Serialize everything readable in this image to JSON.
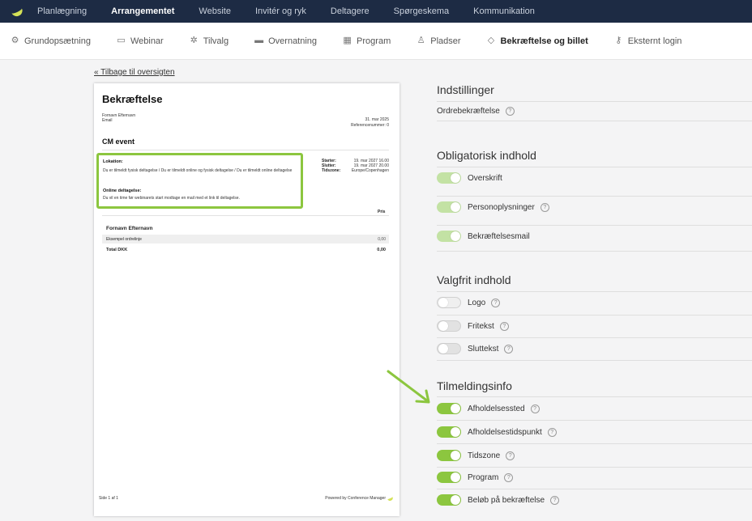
{
  "topnav": {
    "logo_icon": "banana-logo",
    "items": [
      "Planlægning",
      "Arrangementet",
      "Website",
      "Invitér og ryk",
      "Deltagere",
      "Spørgeskema",
      "Kommunikation"
    ],
    "active": "Arrangementet"
  },
  "subnav": {
    "items": [
      {
        "label": "Grundopsætning",
        "icon": "gear-icon"
      },
      {
        "label": "Webinar",
        "icon": "webinar-icon"
      },
      {
        "label": "Tilvalg",
        "icon": "addons-icon"
      },
      {
        "label": "Overnatning",
        "icon": "bed-icon"
      },
      {
        "label": "Program",
        "icon": "calendar-icon"
      },
      {
        "label": "Pladser",
        "icon": "seat-icon"
      },
      {
        "label": "Bekræftelse og billet",
        "icon": "ticket-icon"
      },
      {
        "label": "Eksternt login",
        "icon": "key-icon"
      }
    ],
    "active": "Bekræftelse og billet"
  },
  "back_link": "« Tilbage til oversigten",
  "preview": {
    "title": "Bekræftelse",
    "name": "Fornavn Efternavn",
    "email": "Email",
    "date": "31. mar 2025",
    "reference": "Referencenummer: 0",
    "event": "CM event",
    "location_heading": "Lokation:",
    "location_text": "Du er tilmeldt fysisk deltagelse / Du er tilmeldt online og fysisk deltagelse / Du er tilmeldt online deltagelse",
    "online_heading": "Online deltagelse:",
    "online_text": "Du vil en time før webinarets start modtage en mail med et link til deltagelse.",
    "times": [
      {
        "k": "Starter:",
        "v": "19. mar 2027 16.00"
      },
      {
        "k": "Slutter:",
        "v": "19. mar 2027 20.00"
      },
      {
        "k": "Tidszone:",
        "v": "Europe/Copenhagen"
      }
    ],
    "price_header": "Pris",
    "participant": "Fornavn Efternavn",
    "order_line": "Eksempel ordrelinje",
    "order_value": "0,00",
    "total_label": "Total DKK",
    "total_value": "0,00",
    "footer_left": "Side 1 af 1",
    "footer_right": "Powered by Conference Manager"
  },
  "settings": {
    "sections": [
      {
        "title": "Indstillinger",
        "options": [
          {
            "label": "Ordrebekræftelse",
            "toggle": "none"
          }
        ]
      },
      {
        "title": "Obligatorisk indhold",
        "options": [
          {
            "label": "Overskrift",
            "toggle": "on-disabled"
          },
          {
            "label": "Personoplysninger",
            "toggle": "on-disabled"
          },
          {
            "label": "Bekræftelsesmail",
            "toggle": "on-disabled"
          }
        ]
      },
      {
        "title": "Valgfrit indhold",
        "options": [
          {
            "label": "Logo",
            "toggle": "off"
          },
          {
            "label": "Fritekst",
            "toggle": "off"
          },
          {
            "label": "Sluttekst",
            "toggle": "off"
          }
        ]
      },
      {
        "title": "Tilmeldingsinfo",
        "options": [
          {
            "label": "Afholdelsessted",
            "toggle": "on"
          },
          {
            "label": "Afholdelsestidspunkt",
            "toggle": "on"
          },
          {
            "label": "Tidszone",
            "toggle": "on"
          },
          {
            "label": "Program",
            "toggle": "on"
          },
          {
            "label": "Beløb på bekræftelse",
            "toggle": "on"
          }
        ]
      }
    ],
    "help_glyph": "?"
  },
  "colors": {
    "nav_bg": "#1d2b44",
    "accent": "#8cc63f",
    "accent_disabled": "#c3e2a4"
  }
}
